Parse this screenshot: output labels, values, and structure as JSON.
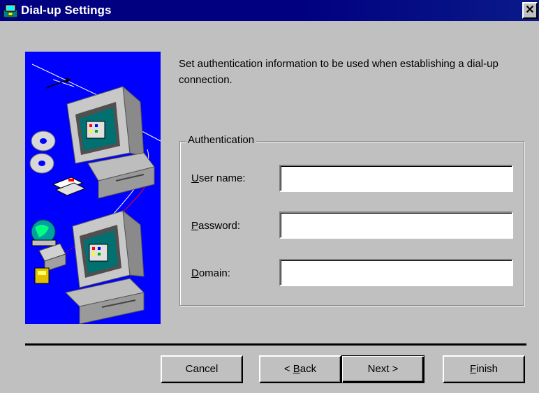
{
  "window": {
    "title": "Dial-up Settings",
    "close_glyph": "✕",
    "icon": "setup-wizard-icon"
  },
  "illustration": {
    "name": "dialup-network-illustration",
    "background_color": "#0000ff"
  },
  "intro": {
    "text": "Set authentication information to be used when establishing a dial-up connection."
  },
  "authentication": {
    "legend": "Authentication",
    "user_name": {
      "label_first": "U",
      "label_rest": "ser name:",
      "value": ""
    },
    "password": {
      "label_first": "P",
      "label_rest": "assword:",
      "value": ""
    },
    "domain": {
      "label_first": "D",
      "label_rest": "omain:",
      "value": ""
    }
  },
  "buttons": {
    "cancel": {
      "label": "Cancel"
    },
    "back": {
      "prefix": "< ",
      "mnemonic": "B",
      "rest": "ack"
    },
    "next": {
      "label": "Next >"
    },
    "finish": {
      "mnemonic": "F",
      "rest": "inish"
    }
  },
  "colors": {
    "title_bar": "#000080",
    "dialog_face": "#c0c0c0",
    "illustration_bg": "#0000ff"
  }
}
